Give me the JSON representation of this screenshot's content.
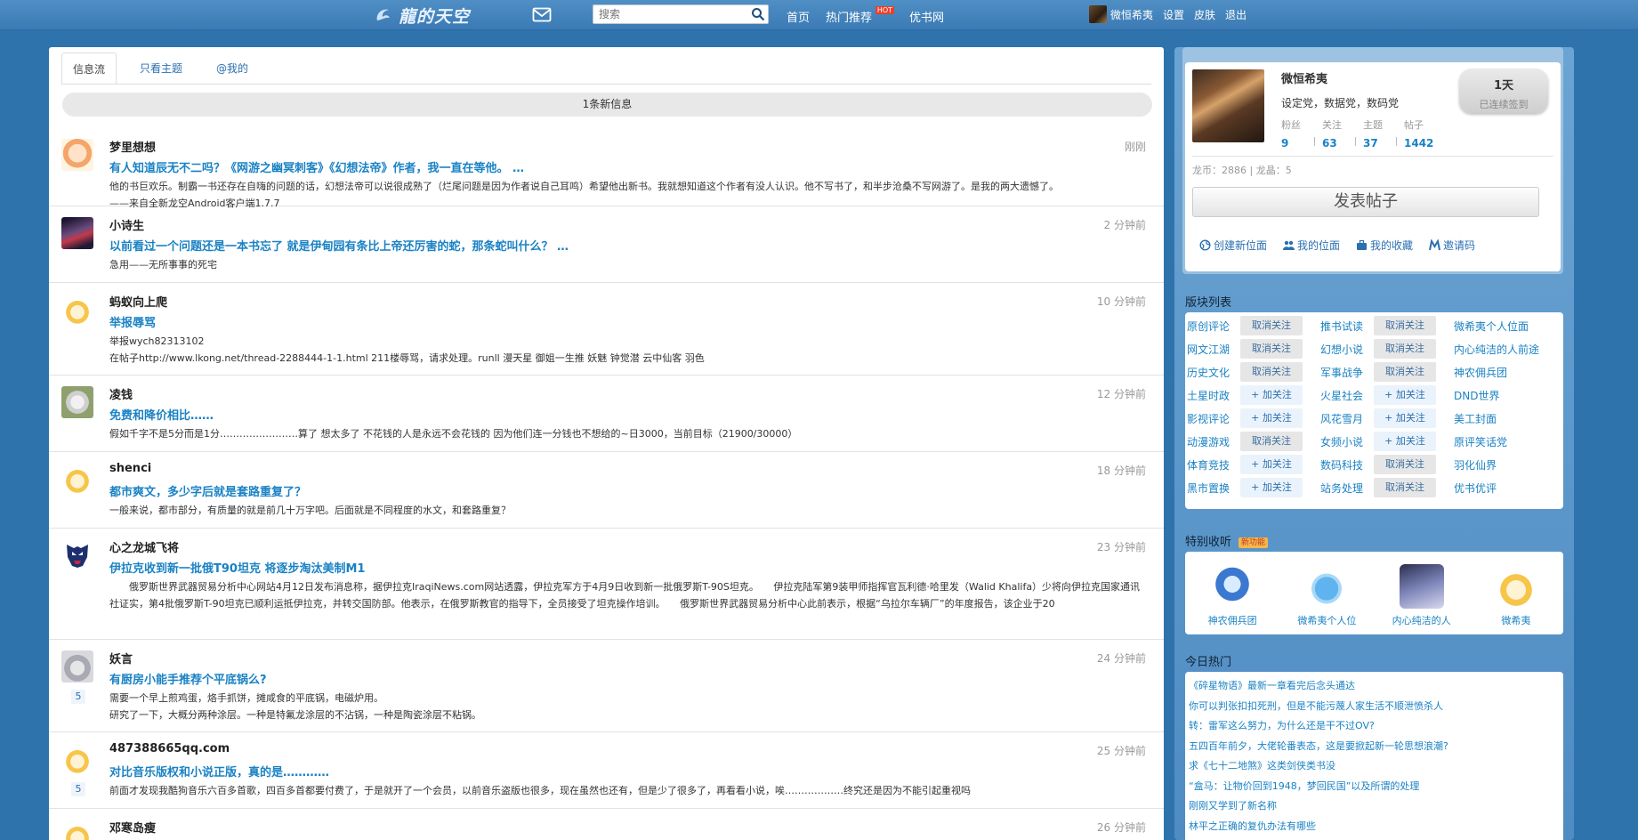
{
  "header": {
    "logo_text": "龍的天空",
    "search_placeholder": "搜索",
    "nav": [
      {
        "label": "首页"
      },
      {
        "label": "热门推荐",
        "badge": "HOT"
      },
      {
        "label": "优书网"
      }
    ],
    "user": {
      "name": "微恒希夷",
      "links": [
        "设置",
        "皮肤",
        "退出"
      ]
    }
  },
  "feed": {
    "tabs": [
      {
        "label": "信息流",
        "active": true
      },
      {
        "label": "只看主题",
        "active": false
      },
      {
        "label": "@我的",
        "active": false
      }
    ],
    "new_info": "1条新信息",
    "posts": [
      {
        "author": "梦里想想",
        "time": "刚刚",
        "avatar": "cartoon-girl-icon",
        "title": "有人知道辰无不二吗？《网游之幽冥刺客》《幻想法帝》作者，我一直在等他。 …",
        "body": [
          "他的书巨欢乐。制霸一书还存在自嗨的问题的话，幻想法帝可以说很成熟了（烂尾问题是因为作者说自己耳鸣）希望他出新书。我就想知道这个作者有没人认识。他不写书了，和半步沧桑不写网游了。是我的两大遗憾了。",
          "——来自全新龙空Android客户端1.7.7"
        ]
      },
      {
        "author": "小诗生",
        "time": "2 分钟前",
        "avatar": "dark-anime-icon",
        "title": "以前看过一个问题还是一本书忘了 就是伊甸园有条比上帝还厉害的蛇，那条蛇叫什么？ …",
        "body": [
          "急用——无所事事的死宅"
        ]
      },
      {
        "author": "蚂蚁向上爬",
        "time": "10 分钟前",
        "avatar": "dragon-mascot-icon",
        "title": "举报辱骂",
        "body": [
          "举报wych82313102",
          "在帖子http://www.lkong.net/thread-2288444-1-1.html 211楼辱骂，请求处理。runll 漫天星 御姐一生推 妖魅 钟觉潜 云中仙客 羽色"
        ]
      },
      {
        "author": "凌钱",
        "time": "12 分钟前",
        "avatar": "cat-photo-icon",
        "title": "免费和降价相比……",
        "body": [
          "假如千字不是5分而是1分……………………算了 想太多了 不花钱的人是永远不会花钱的 因为他们连一分钱也不想给的~日3000，当前目标（21900/30000）"
        ]
      },
      {
        "author": "shenci",
        "time": "18 分钟前",
        "avatar": "dragon-mascot-icon",
        "title": "都市爽文，多少字后就是套路重复了？",
        "body": [
          "一般来说，都市部分，有质量的就是前几十万字吧。后面就是不同程度的水文，和套路重复？"
        ]
      },
      {
        "author": "心之龙城飞将",
        "time": "23 分钟前",
        "avatar": "autobot-logo-icon",
        "title": "伊拉克收到新一批俄T90坦克 将逐步淘汰美制M1",
        "body": [
          "　　俄罗斯世界武器贸易分析中心网站4月12日发布消息称，据伊拉克IraqiNews.com网站透露，伊拉克军方于4月9日收到新一批俄罗斯T-90S坦克。　　伊拉克陆军第9装甲师指挥官瓦利德·哈里发（Walid Khalifa）少将向伊拉克国家通讯社证实，第4批俄罗斯T-90坦克已顺利运抵伊拉克，并转交国防部。他表示，在俄罗斯教官的指导下，全员接受了坦克操作培训。　　俄罗斯世界武器贸易分析中心此前表示，根据“乌拉尔车辆厂”的年度报告，该企业于20"
        ]
      },
      {
        "author": "妖言",
        "time": "24 分钟前",
        "avatar": "gray-cat-icon",
        "badge": "5",
        "title": "有厨房小能手推荐个平底锅么?",
        "body": [
          "需要一个早上煎鸡蛋，烙手抓饼，摊咸食的平底锅，电磁炉用。",
          "研究了一下，大概分两种涂层。一种是特氟龙涂层的不沾锅，一种是陶瓷涂层不粘锅。"
        ]
      },
      {
        "author": "487388665qq.com",
        "time": "25 分钟前",
        "avatar": "dragon-mascot-icon",
        "badge": "5",
        "title": "对比音乐版权和小说正版，真的是…………",
        "body": [
          "前面才发现我酷狗音乐六百多首歌，四百多首都要付费了，于是就开了一个会员，以前音乐盗版也很多，现在虽然也还有，但是少了很多了，再看看小说，唉………………终究还是因为不能引起重视吗"
        ]
      },
      {
        "author": "邓寒岛瘦",
        "time": "26 分钟前",
        "avatar": "dragon-mascot-icon",
        "title": "",
        "body": []
      }
    ]
  },
  "sidebar": {
    "profile": {
      "name": "微恒希夷",
      "desc": "设定党，数据党，数码党",
      "checkin_days": "1天",
      "checkin_label": "已连续签到",
      "stats": [
        {
          "label": "粉丝",
          "value": "9"
        },
        {
          "label": "关注",
          "value": "63"
        },
        {
          "label": "主题",
          "value": "37"
        },
        {
          "label": "帖子",
          "value": "1442"
        }
      ],
      "coins": "龙币：2886 | 龙晶：5",
      "post_button": "发表帖子",
      "quick_links": [
        {
          "label": "创建新位面",
          "icon": "globe-icon"
        },
        {
          "label": "我的位面",
          "icon": "users-icon"
        },
        {
          "label": "我的收藏",
          "icon": "briefcase-icon"
        },
        {
          "label": "邀请码",
          "icon": "invite-m-icon"
        }
      ]
    },
    "boards_title": "版块列表",
    "boards": [
      {
        "name": "原创评论",
        "btn": "取消关注",
        "state": "unfollow"
      },
      {
        "name": "推书试读",
        "btn": "取消关注",
        "state": "unfollow"
      },
      {
        "name": "微希夷个人位面",
        "btn": "",
        "state": "none"
      },
      {
        "name": "网文江湖",
        "btn": "取消关注",
        "state": "unfollow"
      },
      {
        "name": "幻想小说",
        "btn": "取消关注",
        "state": "unfollow"
      },
      {
        "name": "内心纯洁的人前途",
        "btn": "",
        "state": "none"
      },
      {
        "name": "历史文化",
        "btn": "取消关注",
        "state": "unfollow"
      },
      {
        "name": "军事战争",
        "btn": "取消关注",
        "state": "unfollow"
      },
      {
        "name": "神农佣兵团",
        "btn": "",
        "state": "none"
      },
      {
        "name": "土星时政",
        "btn": "+ 加关注",
        "state": "follow"
      },
      {
        "name": "火星社会",
        "btn": "+ 加关注",
        "state": "follow"
      },
      {
        "name": "DND世界",
        "btn": "",
        "state": "none"
      },
      {
        "name": "影视评论",
        "btn": "+ 加关注",
        "state": "follow"
      },
      {
        "name": "风花雪月",
        "btn": "+ 加关注",
        "state": "follow"
      },
      {
        "name": "美工封面",
        "btn": "",
        "state": "none"
      },
      {
        "name": "动漫游戏",
        "btn": "取消关注",
        "state": "unfollow"
      },
      {
        "name": "女频小说",
        "btn": "+ 加关注",
        "state": "follow"
      },
      {
        "name": "原评笑话党",
        "btn": "",
        "state": "none"
      },
      {
        "name": "体育竞技",
        "btn": "+ 加关注",
        "state": "follow"
      },
      {
        "name": "数码科技",
        "btn": "取消关注",
        "state": "unfollow"
      },
      {
        "name": "羽化仙界",
        "btn": "",
        "state": "none"
      },
      {
        "name": "黑市置换",
        "btn": "+ 加关注",
        "state": "follow"
      },
      {
        "name": "站务处理",
        "btn": "取消关注",
        "state": "unfollow"
      },
      {
        "name": "优书优评",
        "btn": "",
        "state": "none"
      }
    ],
    "favs_title": "特别收听",
    "favs_tag": "新功能",
    "favs": [
      {
        "label": "神农佣兵团"
      },
      {
        "label": "微希夷个人位"
      },
      {
        "label": "内心纯洁的人"
      },
      {
        "label": "微希夷"
      }
    ],
    "hot_title": "今日热门",
    "hot": [
      "《碎星物语》最新一章看完后念头通达",
      "你可以判张扣扣死刑，但是不能污蔑人家生活不顺泄愤杀人",
      "转：雷军这么努力，为什么还是干不过OV?",
      "五四百年前夕，大佬轮番表态，这是要掀起新一轮思想浪潮?",
      "求《七十二地煞》这类剑侠类书没",
      "“盒马：让物价回到1948，梦回民国”以及所谓的处理",
      "刚刚又学到了新名称",
      "林平之正确的复仇办法有哪些"
    ]
  }
}
